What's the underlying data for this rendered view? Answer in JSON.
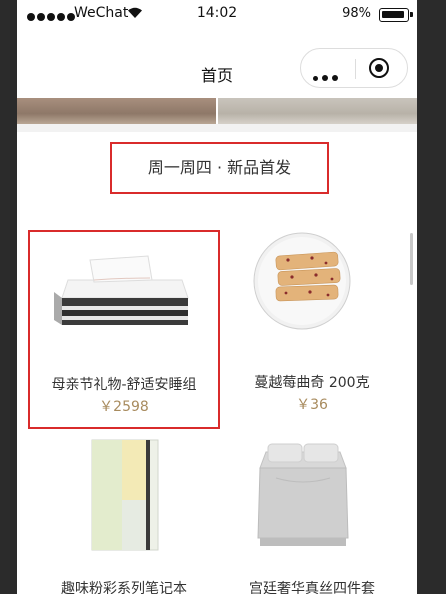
{
  "status_bar": {
    "carrier": "WeChat",
    "time": "14:02",
    "battery": "98%"
  },
  "nav": {
    "title": "首页"
  },
  "section": {
    "title": "周一周四 · 新品首发"
  },
  "products": [
    {
      "name": "母亲节礼物-舒适安睡组",
      "price": "￥2598",
      "icon": "mattress-image"
    },
    {
      "name": "蔓越莓曲奇 200克",
      "price": "￥36",
      "icon": "cookies-image"
    },
    {
      "name": "趣味粉彩系列笔记本",
      "price": "",
      "icon": "notebook-image"
    },
    {
      "name": "宫廷奢华真丝四件套",
      "price": "",
      "icon": "bedding-image"
    }
  ],
  "colors": {
    "highlight": "#d92b2b",
    "price": "#a88b5e"
  }
}
